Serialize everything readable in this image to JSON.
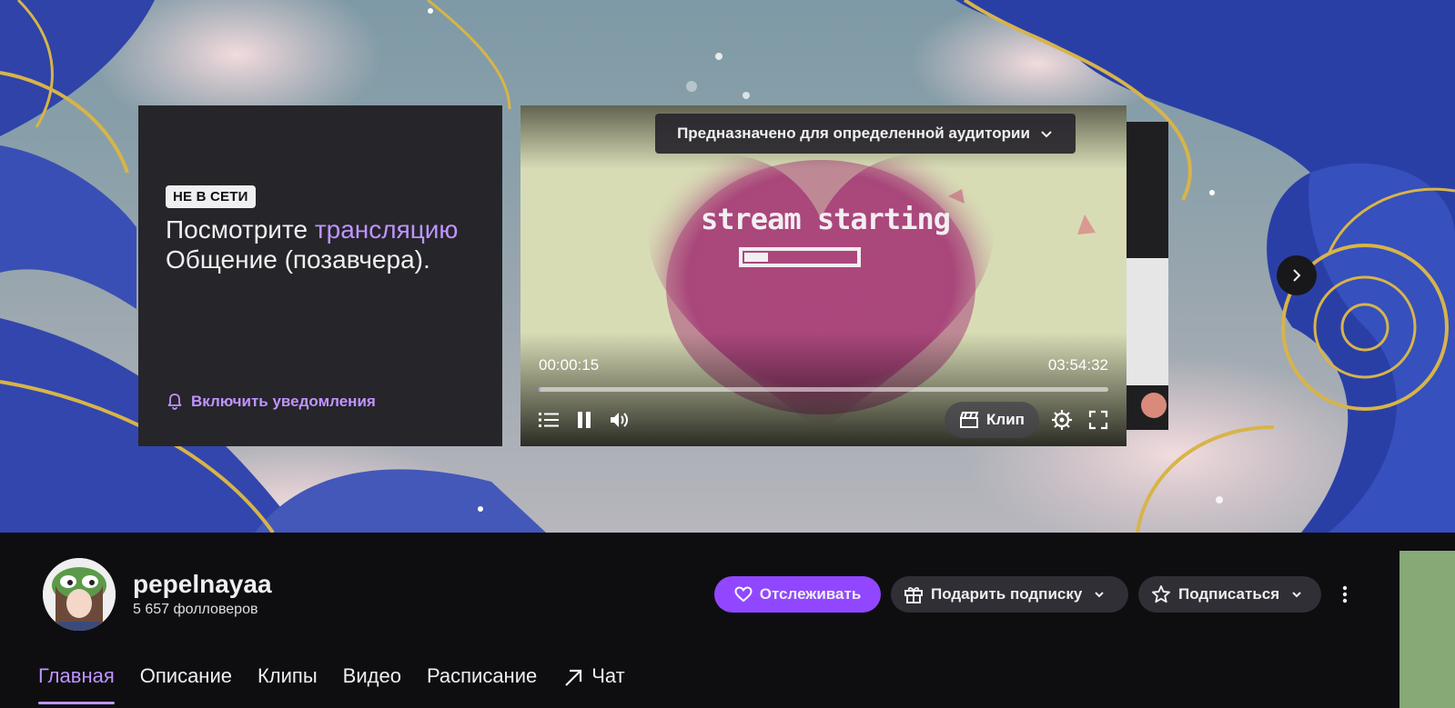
{
  "offline": {
    "badge": "НЕ В СЕТИ",
    "text_before": "Посмотрите ",
    "text_link": "трансляцию",
    "text_after": " Общение (позавчера).",
    "notify_label": "Включить уведомления"
  },
  "player": {
    "audience_label": "Предназначено для определенной аудитории",
    "thumbnail_text": "stream starting",
    "time_current": "00:00:15",
    "time_total": "03:54:32",
    "progress_fraction": 0.0011,
    "clip_label": "Клип"
  },
  "channel": {
    "name": "pepelnayaa",
    "followers": "5 657 фолловеров"
  },
  "actions": {
    "follow_label": "Отслеживать",
    "gift_label": "Подарить подписку",
    "subscribe_label": "Подписаться"
  },
  "tabs": [
    {
      "label": "Главная",
      "active": true
    },
    {
      "label": "Описание",
      "active": false
    },
    {
      "label": "Клипы",
      "active": false
    },
    {
      "label": "Видео",
      "active": false
    },
    {
      "label": "Расписание",
      "active": false
    },
    {
      "label": "Чат",
      "active": false
    }
  ],
  "colors": {
    "accent": "#9147ff",
    "accent_text": "#bf94ff",
    "background": "#0e0e10",
    "button_dark": "#2f2f35"
  }
}
